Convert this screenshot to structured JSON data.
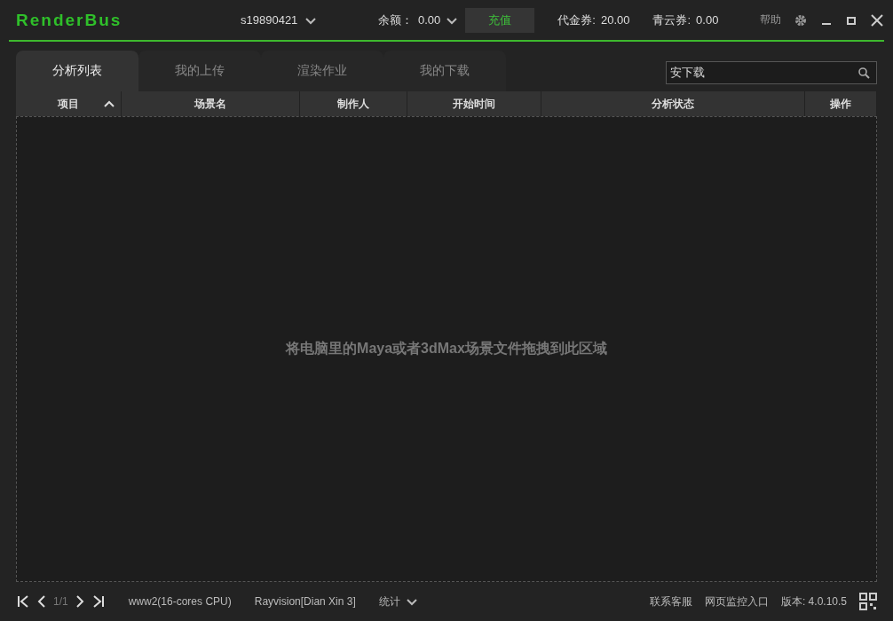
{
  "header": {
    "logo": "RenderBus",
    "account": "s19890421",
    "balance_label": "余额：",
    "balance": "0.00",
    "recharge": "充值",
    "voucher_label": "代金券:",
    "voucher": "20.00",
    "qingyun_label": "青云券:",
    "qingyun": "0.00",
    "help": "帮助"
  },
  "tabs": [
    {
      "label": "分析列表",
      "selected": true
    },
    {
      "label": "我的上传",
      "selected": false
    },
    {
      "label": "渲染作业",
      "selected": false
    },
    {
      "label": "我的下载",
      "selected": false
    }
  ],
  "search": {
    "value": "安下载"
  },
  "table": {
    "columns": [
      {
        "label": "项目",
        "sorted": true
      },
      {
        "label": "场景名",
        "sorted": false
      },
      {
        "label": "制作人",
        "sorted": false
      },
      {
        "label": "开始时间",
        "sorted": false
      },
      {
        "label": "分析状态",
        "sorted": false
      },
      {
        "label": "操作",
        "sorted": false
      }
    ],
    "empty_hint": "将电脑里的Maya或者3dMax场景文件拖拽到此区域"
  },
  "status_bar": {
    "page": "1/1",
    "machine": "www2(16-cores CPU)",
    "platform": "Rayvision[Dian Xin 3]",
    "stats": "统计",
    "contact": "联系客服",
    "monitor": "网页监控入口",
    "version": "版本: 4.0.10.5"
  }
}
